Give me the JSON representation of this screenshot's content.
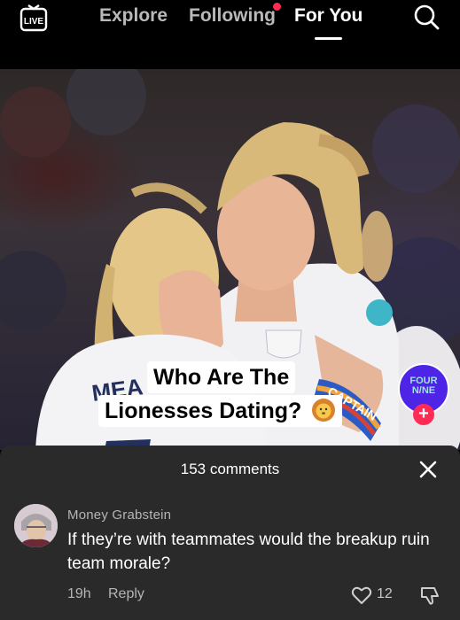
{
  "topbar": {
    "live_label": "LIVE",
    "tabs": [
      {
        "label": "Explore",
        "active": false
      },
      {
        "label": "Following",
        "active": false,
        "has_notification_dot": true
      },
      {
        "label": "For You",
        "active": true
      }
    ],
    "search_icon": "search-icon"
  },
  "video": {
    "caption_line1": "Who Are The",
    "caption_line2": "Lionesses Dating?",
    "caption_emoji": "lion-face-emoji",
    "jersey_text": "MEA",
    "armband_text": "CAPTAIN",
    "channel": {
      "logo_line1": "FOUR",
      "logo_line2": "N/NE",
      "follow_icon": "plus-icon"
    }
  },
  "comments_sheet": {
    "title": "153 comments",
    "close_icon": "close-icon",
    "comments": [
      {
        "username": "Money Grabstein",
        "text": "If they’re with teammates would the breakup ruin team morale?",
        "time": "19h",
        "reply_label": "Reply",
        "likes": "12"
      }
    ]
  },
  "colors": {
    "accent": "#fe2c55",
    "sheet_bg": "#2a2a2a",
    "channel_bg": "#4e24e6"
  }
}
